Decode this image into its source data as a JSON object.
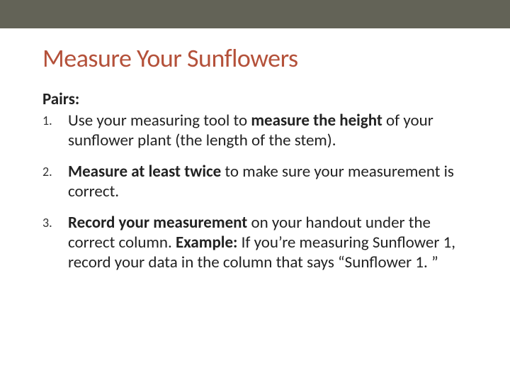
{
  "title": "Measure Your Sunflowers",
  "pairs_label": "Pairs:",
  "steps": [
    {
      "marker": "1.",
      "segments": [
        {
          "t": "Use your measuring tool to ",
          "b": false
        },
        {
          "t": "measure the height",
          "b": true
        },
        {
          "t": " of your sunflower plant (the length of the stem).",
          "b": false
        }
      ]
    },
    {
      "marker": "2.",
      "segments": [
        {
          "t": "Measure at least twice",
          "b": true
        },
        {
          "t": " to make sure your measurement is correct.",
          "b": false
        }
      ]
    },
    {
      "marker": "3.",
      "segments": [
        {
          "t": "Record your measurement",
          "b": true
        },
        {
          "t": " on your handout under the correct column. ",
          "b": false
        },
        {
          "t": "Example:",
          "b": true
        },
        {
          "t": " If you’re measuring Sunflower 1, record your data in the column that says “Sunflower 1. ”",
          "b": false
        }
      ]
    }
  ]
}
